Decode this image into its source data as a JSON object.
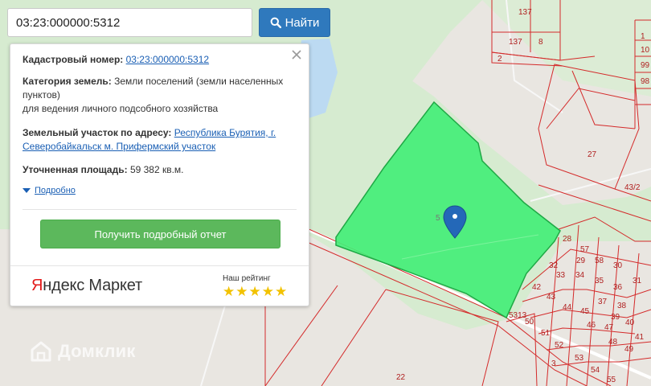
{
  "search": {
    "value": "03:23:000000:5312",
    "button_label": "Найти"
  },
  "info": {
    "cadastral_label": "Кадастровый номер:",
    "cadastral_value": "03:23:000000:5312",
    "category_label": "Категория земель:",
    "category_value": "Земли поселений (земли населенных пунктов)",
    "category_use": "для ведения личного подсобного хозяйства",
    "address_label": "Земельный участок по адресу:",
    "address_value": "Республика Бурятия, г. Северобайкальск м. Прифермский участок",
    "area_label": "Уточненная площадь:",
    "area_value": "59 382 кв.м.",
    "details_label": "Подробно",
    "report_button": "Получить подробный отчет"
  },
  "ad": {
    "logo_ya": "Я",
    "logo_rest": "ндекс Маркет",
    "rating_label": "Наш рейтинг",
    "rating_stars": 5
  },
  "watermark": "Домклик",
  "colors": {
    "parcel_fill": "#44ee77",
    "boundary": "#d42a2a",
    "search_button": "#2f79bd",
    "report_button": "#5cb85c",
    "link": "#1a5fb4",
    "marker": "#2468b8"
  },
  "map": {
    "selected_plot_label": "5",
    "plot_labels": [
      "137",
      "137",
      "8",
      "2",
      "1",
      "10",
      "99",
      "98",
      "27",
      "43/2",
      "28",
      "57",
      "29",
      "58",
      "30",
      "31",
      "32",
      "33",
      "34",
      "35",
      "36",
      "42",
      "43",
      "44",
      "45",
      "46",
      "47",
      "48",
      "49",
      "37",
      "38",
      "39",
      "40",
      "41",
      "5313",
      "50",
      "51",
      "52",
      "53",
      "54",
      "55",
      "3",
      "22"
    ]
  }
}
